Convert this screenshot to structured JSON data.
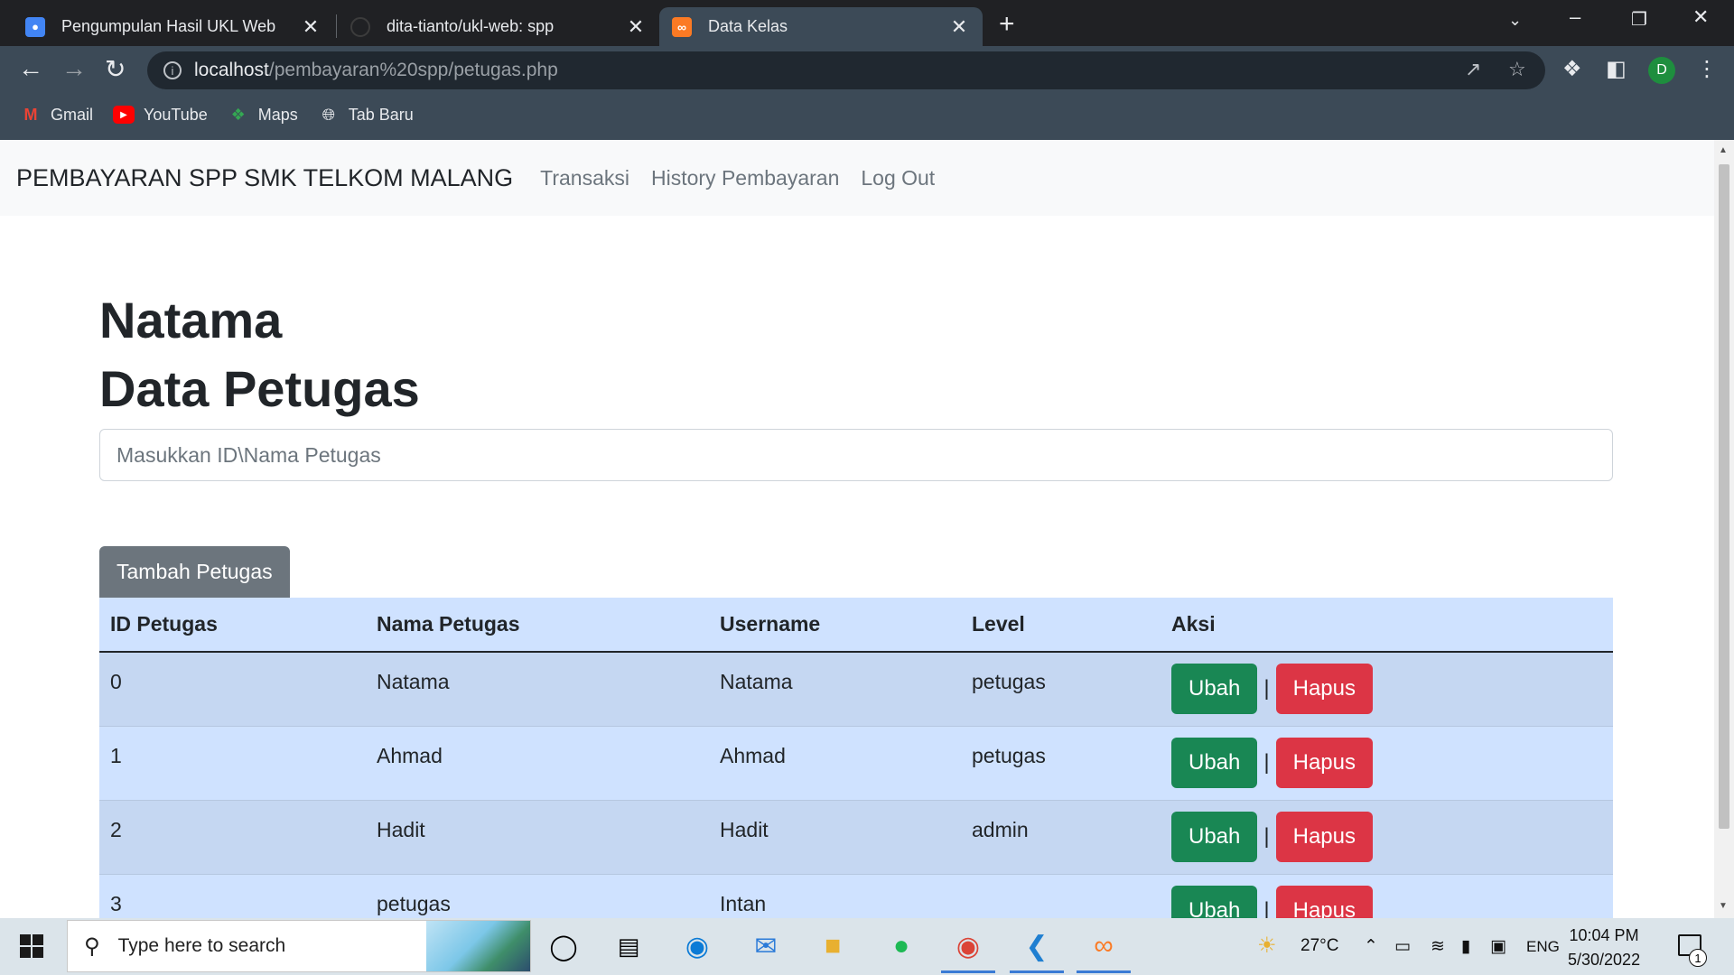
{
  "browser": {
    "tabs": [
      {
        "title": "Pengumpulan Hasil UKL Web",
        "icon": "classroom-icon"
      },
      {
        "title": "dita-tianto/ukl-web: spp",
        "icon": "github-icon"
      },
      {
        "title": "Data Kelas",
        "icon": "xampp-icon",
        "active": true
      }
    ],
    "url_host": "localhost",
    "url_path": "/pembayaran%20spp/petugas.php",
    "profile_initial": "D",
    "bookmarks": [
      {
        "label": "Gmail",
        "icon": "gmail-icon"
      },
      {
        "label": "YouTube",
        "icon": "youtube-icon"
      },
      {
        "label": "Maps",
        "icon": "maps-icon"
      },
      {
        "label": "Tab Baru",
        "icon": "globe-icon"
      }
    ]
  },
  "app": {
    "brand": "PEMBAYARAN SPP SMK TELKOM MALANG",
    "nav": [
      "Transaksi",
      "History Pembayaran",
      "Log Out"
    ],
    "user_name": "Natama",
    "page_title": "Data Petugas",
    "search_placeholder": "Masukkan ID\\Nama Petugas",
    "add_button": "Tambah Petugas",
    "columns": [
      "ID Petugas",
      "Nama Petugas",
      "Username",
      "Level",
      "Aksi"
    ],
    "rows": [
      {
        "id": "0",
        "nama": "Natama",
        "username": "Natama",
        "level": "petugas"
      },
      {
        "id": "1",
        "nama": "Ahmad",
        "username": "Ahmad",
        "level": "petugas"
      },
      {
        "id": "2",
        "nama": "Hadit",
        "username": "Hadit",
        "level": "admin"
      },
      {
        "id": "3",
        "nama": "petugas",
        "username": "Intan",
        "level": ""
      }
    ],
    "action_edit": "Ubah",
    "action_separator": "|",
    "action_delete": "Hapus"
  },
  "taskbar": {
    "search_placeholder": "Type here to search",
    "weather": "27°C",
    "language": "ENG",
    "time": "10:04 PM",
    "date": "5/30/2022",
    "notification_count": "1"
  },
  "colors": {
    "success": "#198754",
    "danger": "#dc3545",
    "secondary": "#6c757d",
    "table_primary": "#cfe2ff"
  }
}
